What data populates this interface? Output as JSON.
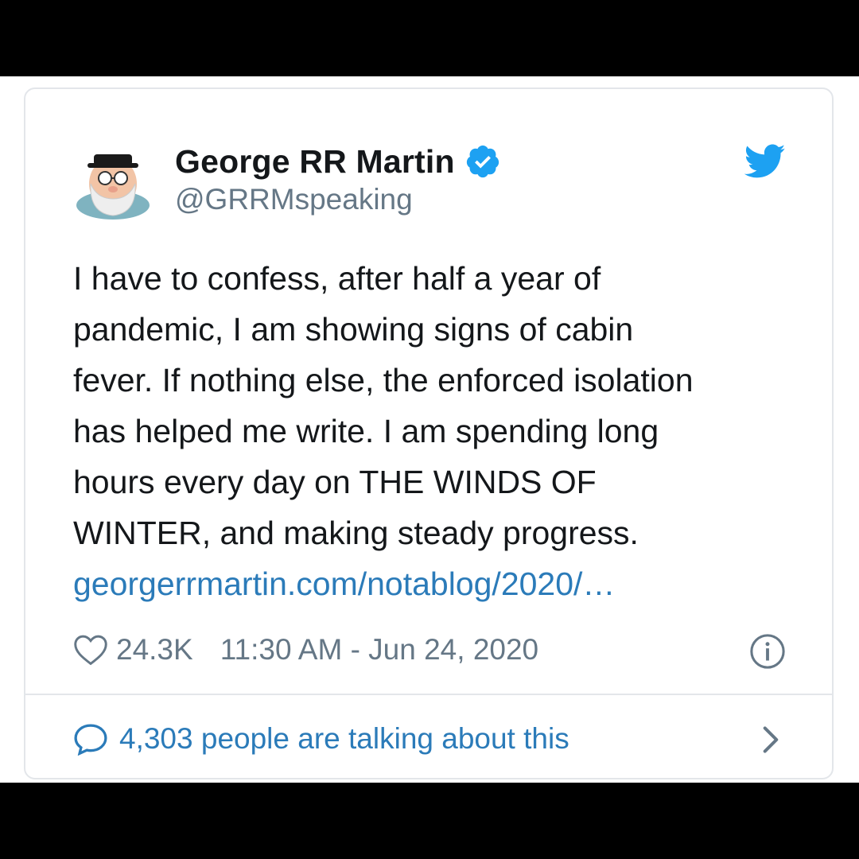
{
  "colors": {
    "page_background": "#000000",
    "card_background": "#ffffff",
    "card_border": "#e3e6ea",
    "text_primary": "#14171a",
    "text_secondary": "#657786",
    "link": "#2b7bb9",
    "twitter_blue": "#1da1f2"
  },
  "author": {
    "display_name": "George RR Martin",
    "handle": "@GRRMspeaking",
    "verified": true,
    "avatar_icon": "avatar-illustration",
    "verified_icon": "verified-badge-icon"
  },
  "brand_icon": "twitter-bird-icon",
  "tweet": {
    "lines": [
      "I have to confess, after half a year of",
      "pandemic, I am showing signs of cabin",
      "fever. If nothing else, the enforced isolation",
      "has helped me write. I am spending long",
      "hours every day on THE WINDS OF",
      "WINTER, and making steady progress."
    ],
    "link": "georgerrmartin.com/notablog/2020/…"
  },
  "meta": {
    "like_icon": "heart-icon",
    "likes": "24.3K",
    "timestamp": "11:30 AM - Jun 24, 2020",
    "info_icon": "info-icon"
  },
  "footer": {
    "reply_icon": "speech-bubble-icon",
    "talking_text": "4,303 people are talking about this",
    "chevron_icon": "chevron-right-icon"
  }
}
